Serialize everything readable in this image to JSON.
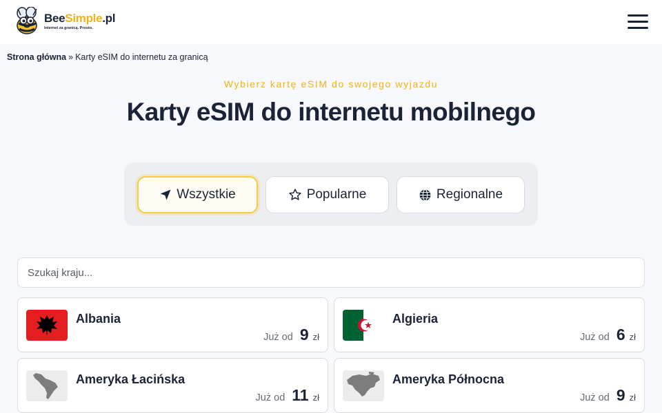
{
  "header": {
    "logo_name_dark": "Bee",
    "logo_name_accent": "Simple",
    "logo_name_suffix": ".pl",
    "logo_tagline": "Internet za granicą. Prosto.",
    "menu_icon": "hamburger-icon"
  },
  "breadcrumb": {
    "home": "Strona główna",
    "separator": "»",
    "current": "Karty eSIM do internetu za granicą"
  },
  "hero": {
    "subtitle": "Wybierz kartę eSIM do swojego wyjazdu",
    "title": "Karty eSIM do internetu mobilnego"
  },
  "filters": [
    {
      "label": "Wszystkie",
      "icon": "location-arrow-icon",
      "active": true
    },
    {
      "label": "Popularne",
      "icon": "star-icon",
      "active": false
    },
    {
      "label": "Regionalne",
      "icon": "globe-icon",
      "active": false
    }
  ],
  "search": {
    "placeholder": "Szukaj kraju...",
    "value": ""
  },
  "countries": [
    {
      "name": "Albania",
      "from_label": "Już od",
      "price": "9",
      "currency": "zł",
      "flag": "albania-flag"
    },
    {
      "name": "Algieria",
      "from_label": "Już od",
      "price": "6",
      "currency": "zł",
      "flag": "algeria-flag"
    },
    {
      "name": "Ameryka Łacińska",
      "from_label": "Już od",
      "price": "11",
      "currency": "zł",
      "flag": "latin-america-map"
    },
    {
      "name": "Ameryka Północna",
      "from_label": "Już od",
      "price": "9",
      "currency": "zł",
      "flag": "north-america-map"
    }
  ],
  "colors": {
    "accent": "#f0b21a",
    "text": "#1b2336",
    "albania_red": "#e41e20",
    "algeria_green": "#006233",
    "algeria_red": "#d21034"
  }
}
